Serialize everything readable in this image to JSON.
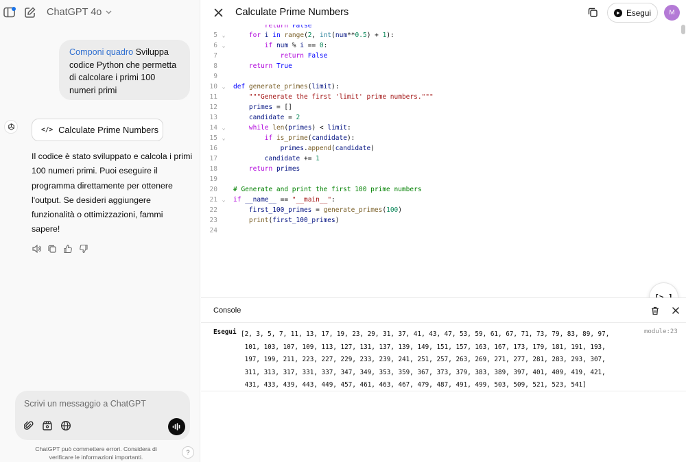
{
  "header": {
    "model_label": "ChatGPT 4o"
  },
  "chat": {
    "user_message_highlight": "Componi quadro",
    "user_message_text": " Sviluppa codice Python che permetta di calcolare i primi 100 numeri primi",
    "canvas_chip_label": "Calculate Prime Numbers",
    "assistant_text": "Il codice è stato sviluppato e calcola i primi 100 numeri primi. Puoi eseguire il programma direttamente per ottenere l'output. Se desideri aggiungere funzionalità o ottimizzazioni, fammi sapere!",
    "composer_placeholder": "Scrivi un messaggio a ChatGPT",
    "disclaimer": "ChatGPT può commettere errori. Considera di verificare le informazioni importanti.",
    "help_label": "?"
  },
  "canvas": {
    "title": "Calculate Prime Numbers",
    "run_label": "Esegui",
    "profile_initial": "M",
    "fab_label": "[>_]",
    "code_lines": [
      {
        "n": "5",
        "fold": true
      },
      {
        "n": "6",
        "fold": true
      },
      {
        "n": "7",
        "fold": false
      },
      {
        "n": "8",
        "fold": false
      },
      {
        "n": "9",
        "fold": false
      },
      {
        "n": "10",
        "fold": true
      },
      {
        "n": "11",
        "fold": false
      },
      {
        "n": "12",
        "fold": false
      },
      {
        "n": "13",
        "fold": false
      },
      {
        "n": "14",
        "fold": true
      },
      {
        "n": "15",
        "fold": true
      },
      {
        "n": "16",
        "fold": false
      },
      {
        "n": "17",
        "fold": false
      },
      {
        "n": "18",
        "fold": false
      },
      {
        "n": "19",
        "fold": false
      },
      {
        "n": "20",
        "fold": false
      },
      {
        "n": "21",
        "fold": true
      },
      {
        "n": "22",
        "fold": false
      },
      {
        "n": "23",
        "fold": false
      },
      {
        "n": "24",
        "fold": false
      }
    ]
  },
  "console": {
    "title": "Console",
    "run_label": "Esegui",
    "source": "module:23",
    "output": "[2, 3, 5, 7, 11, 13, 17, 19, 23, 29, 31, 37, 41, 43, 47, 53, 59, 61, 67, 71, 73, 79, 83, 89, 97,\n 101, 103, 107, 109, 113, 127, 131, 137, 139, 149, 151, 157, 163, 167, 173, 179, 181, 191, 193,\n 197, 199, 211, 223, 227, 229, 233, 239, 241, 251, 257, 263, 269, 271, 277, 281, 283, 293, 307,\n 311, 313, 317, 331, 337, 347, 349, 353, 359, 367, 373, 379, 383, 389, 397, 401, 409, 419, 421,\n 431, 433, 439, 443, 449, 457, 461, 463, 467, 479, 487, 491, 499, 503, 509, 521, 523, 541]"
  },
  "colors": {
    "highlight": "#2f6fd0",
    "profile": "#b47ad6",
    "keyword": "#0000ff",
    "string": "#a31515",
    "comment": "#008000"
  },
  "icons": [
    "sidebar-icon",
    "new-chat-icon",
    "chevron-down-icon",
    "openai-logo-icon",
    "code-icon",
    "speaker-icon",
    "copy-icon",
    "thumbs-up-icon",
    "thumbs-down-icon",
    "attach-icon",
    "tools-icon",
    "globe-icon",
    "voice-icon",
    "close-icon",
    "play-icon",
    "trash-icon"
  ]
}
